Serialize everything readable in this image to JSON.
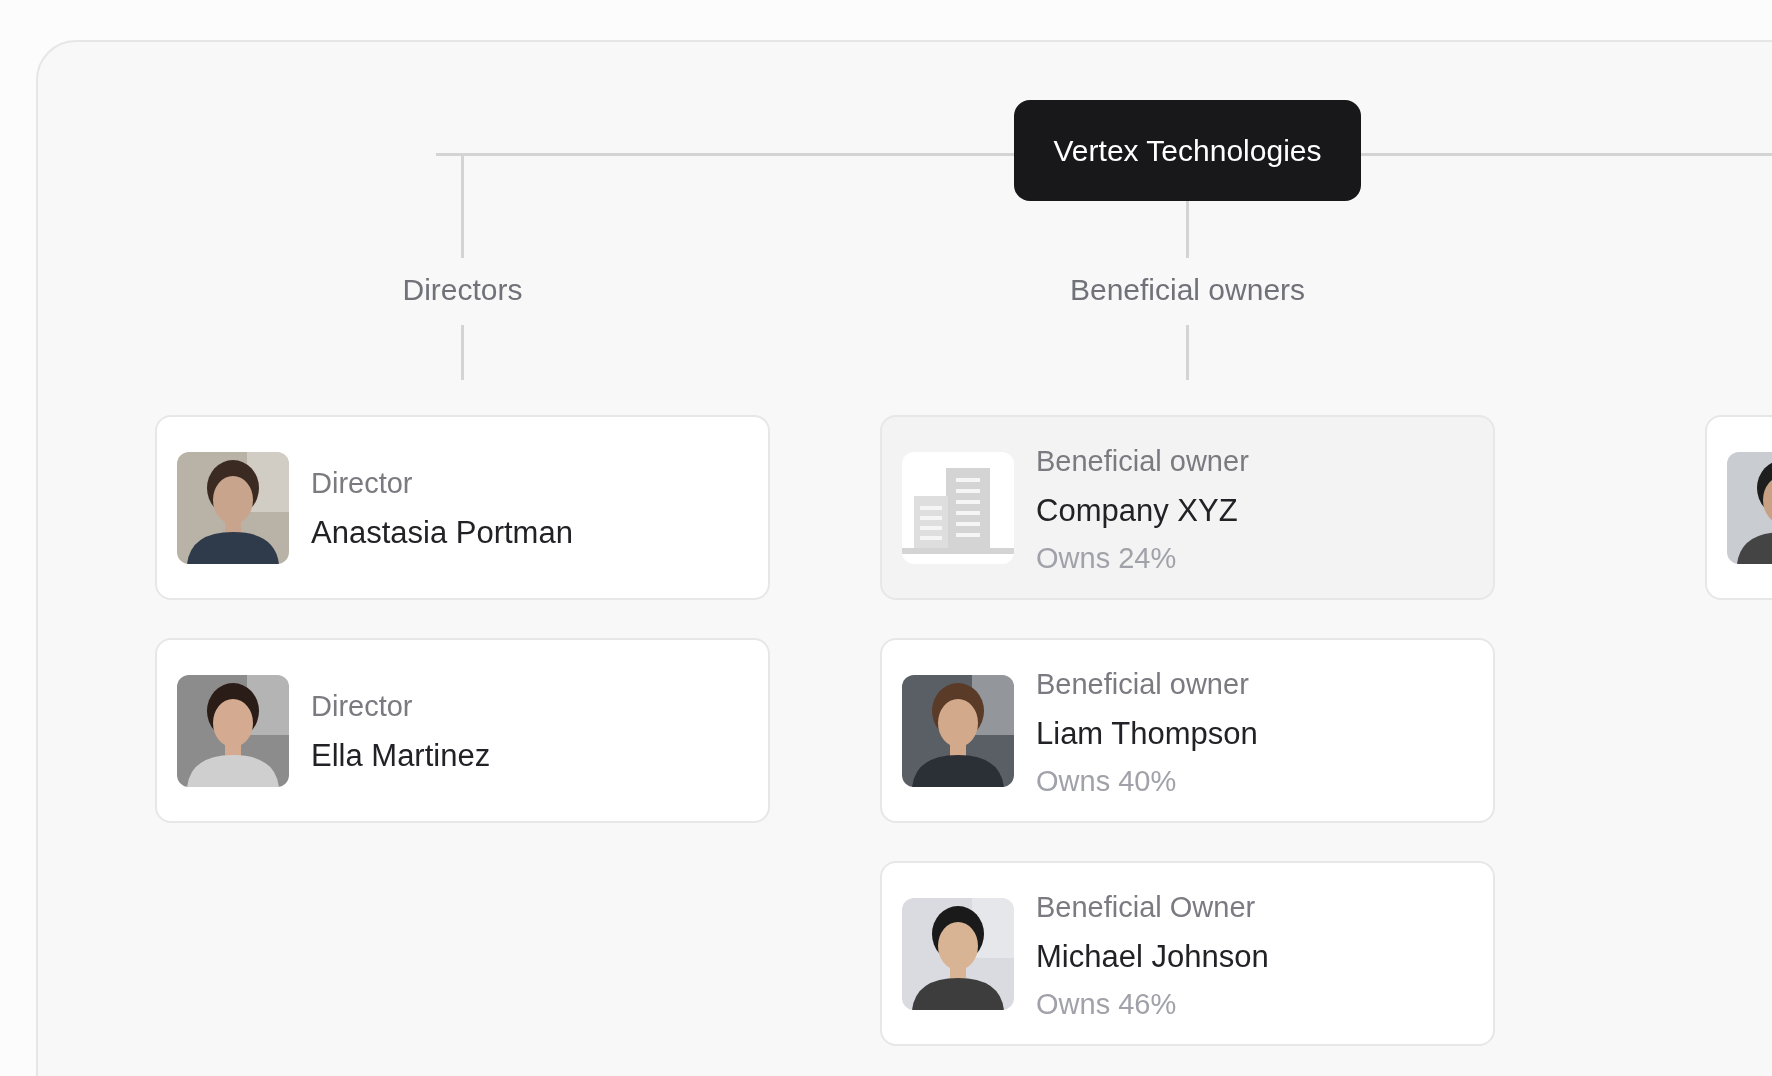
{
  "root": {
    "title": "Vertex Technologies"
  },
  "columns": [
    {
      "label": "Directors",
      "cards": [
        {
          "kind": "person",
          "role": "Director",
          "name": "Anastasia Portman"
        },
        {
          "kind": "person",
          "role": "Director",
          "name": "Ella Martinez"
        }
      ]
    },
    {
      "label": "Beneficial owners",
      "cards": [
        {
          "kind": "company",
          "role": "Beneficial owner",
          "name": "Company XYZ",
          "share": "Owns 24%"
        },
        {
          "kind": "person",
          "role": "Beneficial owner",
          "name": "Liam Thompson",
          "share": "Owns 40%"
        },
        {
          "kind": "person",
          "role": "Beneficial Owner",
          "name": "Michael Johnson",
          "share": "Owns 46%"
        }
      ]
    },
    {
      "cards": [
        {
          "kind": "person"
        }
      ]
    }
  ]
}
